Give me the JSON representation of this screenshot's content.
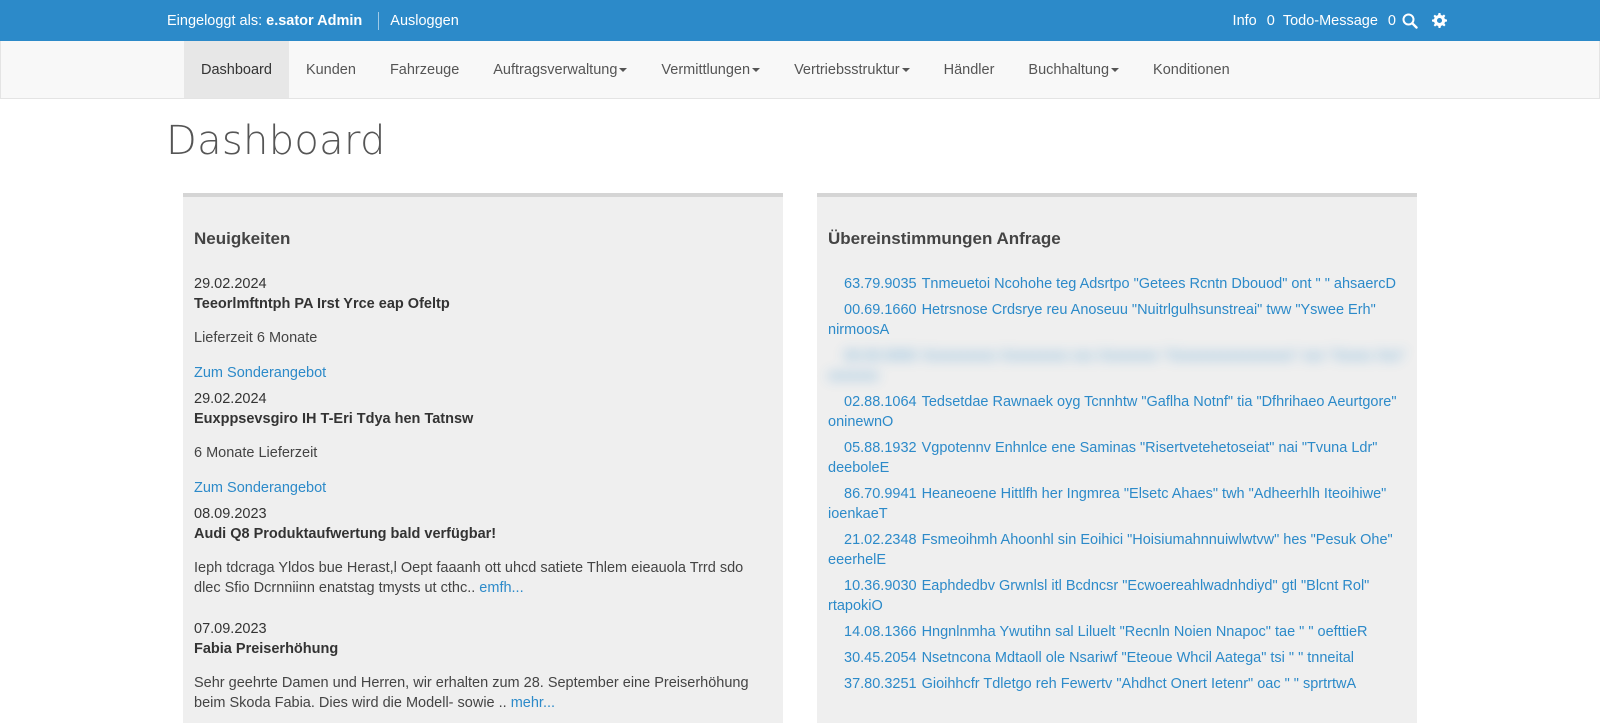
{
  "topbar": {
    "logged_in_label": "Eingeloggt als:",
    "user_name": "e.sator Admin",
    "logout_label": "Ausloggen",
    "info_label": "Info",
    "info_count": "0",
    "todo_label": "Todo-Message",
    "todo_count": "0",
    "icons": [
      "search-icon",
      "gear-icon"
    ]
  },
  "nav": {
    "items": [
      {
        "label": "Dashboard",
        "active": true,
        "dropdown": false
      },
      {
        "label": "Kunden",
        "dropdown": false
      },
      {
        "label": "Fahrzeuge",
        "dropdown": false
      },
      {
        "label": "Auftragsverwaltung",
        "dropdown": true
      },
      {
        "label": "Vermittlungen",
        "dropdown": true
      },
      {
        "label": "Vertriebsstruktur",
        "dropdown": true
      },
      {
        "label": "Händler",
        "dropdown": false
      },
      {
        "label": "Buchhaltung",
        "dropdown": true
      },
      {
        "label": "Konditionen",
        "dropdown": false
      }
    ]
  },
  "page": {
    "title": "Dashboard"
  },
  "news": {
    "title": "Neuigkeiten",
    "items": [
      {
        "date": "29.02.2024",
        "title": "Teeorlmftntph PA Irst Yrce eap Ofeltp",
        "body": "Lieferzeit 6 Monate",
        "link": "Zum Sonderangebot"
      },
      {
        "date": "29.02.2024",
        "title": "Euxppsevsgiro IH T-Eri Tdya hen Tatnsw",
        "body": "6 Monate Lieferzeit",
        "link": "Zum Sonderangebot"
      },
      {
        "date": "08.09.2023",
        "title": "Audi Q8 Produktaufwertung bald verfügbar!",
        "body": "Ieph tdcraga Yldos bue Herast,l Oept faaanh ott uhcd satiete Thlem eieauola Trrd sdo dlec Sfio Dcrnniinn enatstag tmysts ut cthc..",
        "more": "emfh..."
      },
      {
        "date": "07.09.2023",
        "title": "Fabia Preiserhöhung",
        "body": "Sehr geehrte Damen und Herren, wir erhalten zum 28. September eine Preiserhöhung beim Skoda Fabia. Dies wird die Modell- sowie ..",
        "more": "mehr..."
      }
    ]
  },
  "matches": {
    "title": "Übereinstimmungen Anfrage",
    "items": [
      {
        "num": "63.79.9035",
        "text": "Tnmeuetoi Ncohohe teg Adsrtpo \"Getees Rcntn Dbouod\" ont \" \" ahsaercD"
      },
      {
        "num": "00.69.1660",
        "text": "Hetrsnose Crdsrye reu Anoseuu \"Nuitrlgulhsunstreai\" tww \"Yswee Erh\" nirmoosA"
      },
      {
        "num": "00.00.0000",
        "text": "Xxxxxxxxxx Xxxxxxxxx xxx Xxxxxxxx \"Xxxxxxxxxxxxxxxxx\" xxx \"Xxxxx Xxx\" xxxxxxx",
        "blurred": true
      },
      {
        "num": "02.88.1064",
        "text": "Tedsetdae Rawnaek oyg Tcnnhtw \"Gaflha Notnf\" tia \"Dfhrihaeo Aeurtgore\" oninewnO"
      },
      {
        "num": "05.88.1932",
        "text": "Vgpotennv Enhnlce ene Saminas \"Risertvetehetoseiat\" nai \"Tvuna Ldr\" deeboleE"
      },
      {
        "num": "86.70.9941",
        "text": "Heaneoene Hittlfh her Ingmrea \"Elsetc Ahaes\" twh \"Adheerhlh Iteoihiwe\" ioenkaeT"
      },
      {
        "num": "21.02.2348",
        "text": "Fsmeoihmh Ahoonhl sin Eoihici \"Hoisiumahnnuiwlwtvw\" hes \"Pesuk Ohe\" eeerhelE"
      },
      {
        "num": "10.36.9030",
        "text": "Eaphdedbv Grwnlsl itl Bcdncsr \"Ecwoereahlwadnhdiyd\" gtl \"Blcnt Rol\" rtapokiO"
      },
      {
        "num": "14.08.1366",
        "text": "Hngnlnmha Ywutihn sal Liluelt \"Recnln Noien Nnapoc\" tae \" \" oefttieR"
      },
      {
        "num": "30.45.2054",
        "text": "Nsetncona Mdtaoll ole Nsariwf \"Eteoue Whcil Aatega\" tsi \" \" tnneital"
      },
      {
        "num": "37.80.3251",
        "text": "Gioihhcfr Tdletgo reh Fewertv \"Ahdhct Onert Ietenr\" oac \" \" sprtrtwA"
      }
    ]
  }
}
